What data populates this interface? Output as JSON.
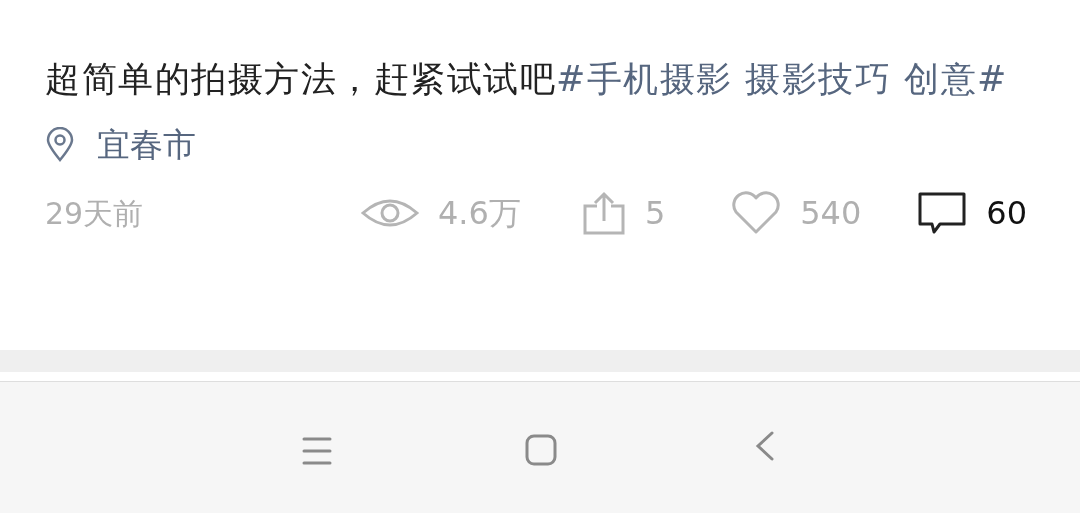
{
  "post": {
    "text": "超简单的拍摄方法，赶紧试试吧",
    "tags": "#手机摄影 摄影技巧 创意#",
    "location": "宜春市",
    "time": "29天前",
    "stats": [
      {
        "kind": "views",
        "value": "4.6万"
      },
      {
        "kind": "shares",
        "value": "5"
      },
      {
        "kind": "likes",
        "value": "540"
      },
      {
        "kind": "comments",
        "value": "60"
      }
    ]
  },
  "nav_bar": {
    "buttons": [
      {
        "kind": "menu"
      },
      {
        "kind": "home"
      },
      {
        "kind": "back"
      }
    ]
  }
}
